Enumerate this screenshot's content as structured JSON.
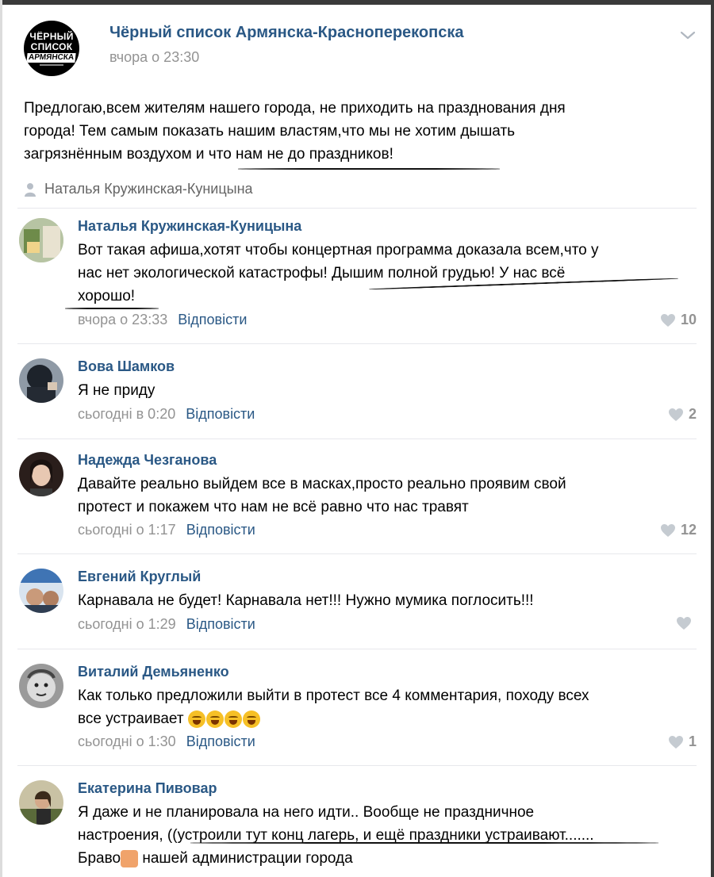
{
  "post": {
    "avatar_lines": [
      "ЧЁРНЫЙ",
      "СПИСОК",
      "АРМЯНСКА"
    ],
    "group_name": "Чёрный список Армянска-Красноперекопска",
    "time": "вчора о 23:30",
    "text_lines": [
      "Предлогаю,всем жителям нашего города, не приходить на празднования дня",
      "города! Тем самым показать нашим властям,что мы не хотим дышать",
      "загрязнённым воздухом и что нам не до праздников!"
    ],
    "author": "Наталья Кружинская-Куницына",
    "menu_icon": "chevron-down-icon"
  },
  "comments": [
    {
      "name": "Наталья Кружинская-Куницына",
      "lines": [
        "Вот такая афиша,хотят чтобы концертная программа доказала всем,что у",
        "нас нет экологической катастрофы! Дышим полной грудью! У нас всё",
        "хорошо!"
      ],
      "time": "вчора о 23:33",
      "reply": "Відповісти",
      "likes": "10",
      "avatar_color": "#7a9a5a"
    },
    {
      "name": "Вова Шамков",
      "lines": [
        "Я не приду"
      ],
      "time": "сьогодні в 0:20",
      "reply": "Відповісти",
      "likes": "2",
      "avatar_color": "#2c3440"
    },
    {
      "name": "Надежда Чезганова",
      "lines": [
        "Давайте реально выйдем все в масках,просто реально проявим свой",
        "протест и покажем что нам не всё равно что нас травят"
      ],
      "time": "сьогодні о 1:17",
      "reply": "Відповісти",
      "likes": "12",
      "avatar_color": "#3a2a26"
    },
    {
      "name": "Евгений Круглый",
      "lines": [
        "Карнавала не будет! Карнавала нет!!! Нужно мумика поглосить!!!"
      ],
      "time": "сьогодні о 1:29",
      "reply": "Відповісти",
      "likes": "",
      "avatar_color": "#5a7fa8"
    },
    {
      "name": "Виталий Демьяненко",
      "lines": [
        "Как только предложили выйти в протест все 4 комментария, походу всех",
        "все устраивает"
      ],
      "time": "сьогодні о 1:30",
      "reply": "Відповісти",
      "likes": "1",
      "avatar_color": "#6b6b6b"
    },
    {
      "name": "Екатерина Пивовар",
      "lines": [
        "Я даже и не планировала на него идти.. Вообще не праздничное",
        "настроения, ((устроили тут конц лагерь, и ещё праздники устраивают.......",
        "Браво",
        "нашей администрации города"
      ],
      "time": "",
      "reply": "",
      "likes": "",
      "avatar_color": "#6a6040"
    }
  ],
  "colors": {
    "link": "#2a5885",
    "meta": "#939393",
    "author": "#656565",
    "separator": "#e7e8ec"
  }
}
